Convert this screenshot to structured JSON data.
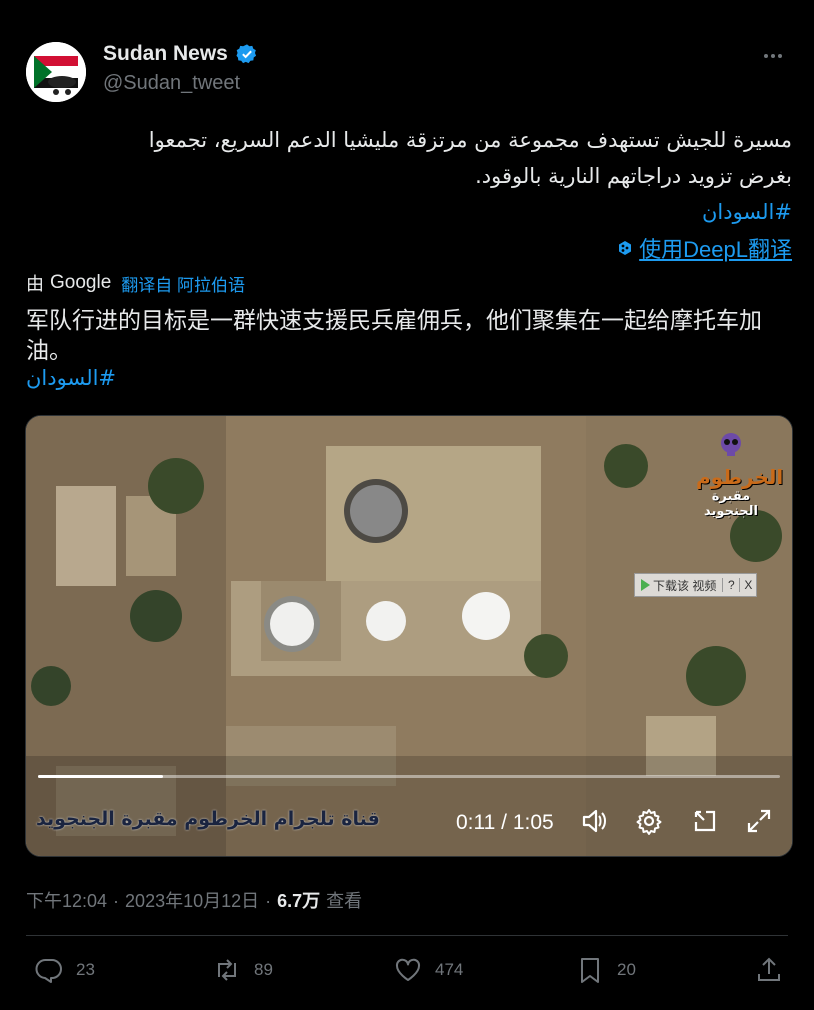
{
  "account": {
    "display_name": "Sudan News",
    "handle": "@Sudan_tweet",
    "verified_icon": "verified-badge-icon",
    "avatar_icon": "sudan-flag-avatar"
  },
  "tweet": {
    "original_line1": "مسيرة للجيش تستهدف مجموعة من مرتزقة مليشيا الدعم السريع، تجمعوا",
    "original_line2": "بغرض تزويد دراجاتهم النارية بالوقود.",
    "original_hashtag": "#السودان",
    "deepl_label": "使用DeepL翻译",
    "translated_prefix": "由",
    "translated_engine": "Google",
    "translated_from": "翻译自 阿拉伯语",
    "translation_text": "军队行进的目标是一群快速支援民兵雇佣兵，他们聚集在一起给摩托车加油。",
    "translation_hashtag": "#السودان"
  },
  "video": {
    "watermark_title": "الخرطوم",
    "watermark_subtitle": "مقبرة الجنجويد",
    "download_label": "下载该 视频",
    "download_help": "?",
    "download_close": "X",
    "channel_caption": "قناة تلجرام الخرطوم مقبرة الجنجويد",
    "current_time": "0:11",
    "duration": "1:05",
    "time_display": "0:11 / 1:05",
    "progress_fraction": 0.169
  },
  "meta": {
    "time": "下午12:04",
    "sep1": "·",
    "date": "2023年10月12日",
    "sep2": "·",
    "views_count": "6.7万",
    "views_label": "查看"
  },
  "actions": {
    "reply_count": "23",
    "retweet_count": "89",
    "like_count": "474",
    "bookmark_count": "20"
  },
  "colors": {
    "background": "#000000",
    "text": "#e7e9ea",
    "muted": "#71767b",
    "accent": "#1d9bf0",
    "divider": "#2f3336"
  }
}
